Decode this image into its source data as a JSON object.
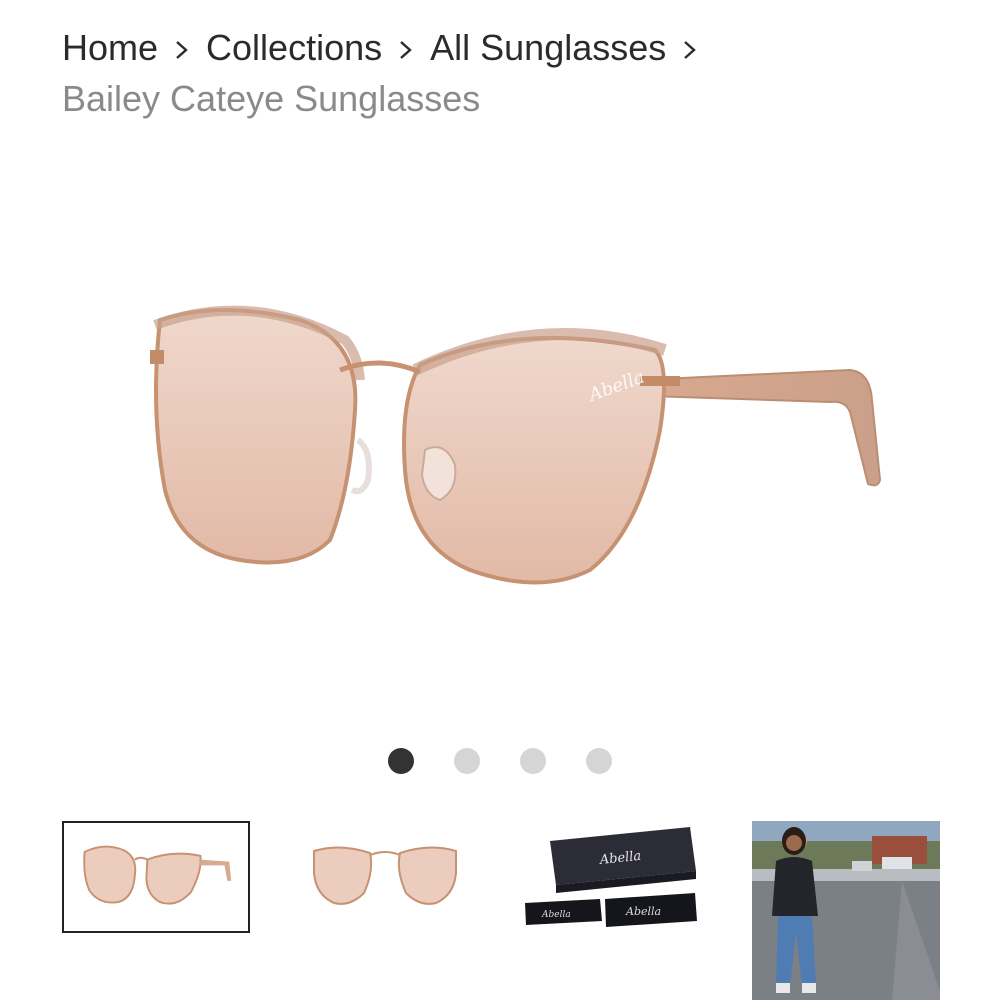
{
  "breadcrumb": {
    "items": [
      "Home",
      "Collections",
      "All Sunglasses"
    ],
    "current": "Bailey Cateye Sunglasses"
  },
  "product": {
    "brand_mark": "Abella",
    "lens_color": "#e8c4b4",
    "frame_color": "#c89a7c"
  },
  "gallery": {
    "slide_count": 4,
    "active_slide": 1
  },
  "thumbnails": [
    {
      "label": "thumbnail-angle-view",
      "selected": true
    },
    {
      "label": "thumbnail-front-view",
      "selected": false
    },
    {
      "label": "thumbnail-packaging",
      "selected": false,
      "box_text": "Abella",
      "pouch_text_left": "Abella",
      "pouch_text_right": "Abella"
    },
    {
      "label": "thumbnail-lifestyle-photo",
      "selected": false
    }
  ]
}
